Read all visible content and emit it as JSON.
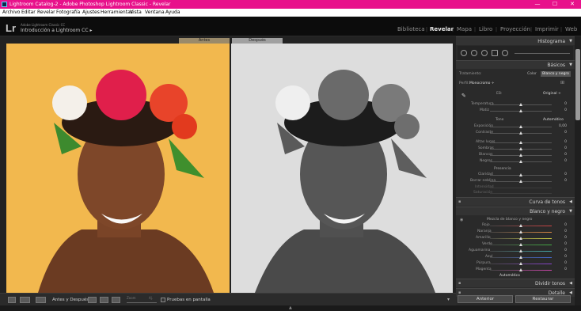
{
  "window": {
    "title": "Lightroom Catalog-2 - Adobe Photoshop Lightroom Classic - Revelar",
    "minimize": "—",
    "maximize": "☐",
    "close": "✕"
  },
  "menu": [
    "Archivo",
    "Editar",
    "Revelar",
    "Fotografía",
    "Ajustes",
    "Herramientas",
    "Vista",
    "Ventana",
    "Ayuda"
  ],
  "identity": {
    "logo": "Lr",
    "subtitle": "Adobe Lightroom Classic CC",
    "catalog": "Introducción a Lightroom CC ▸"
  },
  "modules": [
    "Biblioteca",
    "Revelar",
    "Mapa",
    "Libro",
    "Proyección",
    "Imprimir",
    "Web"
  ],
  "active_module": "Revelar",
  "view_labels": {
    "before": "Antes",
    "after": "Después"
  },
  "toolbar": {
    "mode_label": "Antes y Después:",
    "zoom_label": "Zoom",
    "fit_label": "Aj.",
    "proofing_label": "Pruebas en pantalla"
  },
  "panels": {
    "histogram": "Histograma",
    "basic": "Básicos",
    "tone_curve": "Curva de tonos",
    "bw": "Blanco y negro",
    "split_toning": "Dividir tonos",
    "detail": "Detalle"
  },
  "basic": {
    "treatment_label": "Tratamiento:",
    "color": "Color",
    "bw": "Blanco y negro",
    "profile_label": "Perfil:",
    "profile_value": "Monocromo ÷",
    "wb_label": "EB:",
    "wb_value": "Original ÷",
    "temperature": "Temperatura",
    "tint": "Matiz",
    "tone_label": "Tono",
    "auto": "Automático",
    "exposure": "Exposición",
    "exposure_value": "0,00",
    "contrast": "Contraste",
    "highlights": "Altas luces",
    "shadows": "Sombras",
    "whites": "Blancos",
    "blacks": "Negros",
    "presence_label": "Presencia",
    "clarity": "Claridad",
    "dehaze": "Borrar neblina",
    "vibrance": "Intensidad",
    "saturation": "Saturación",
    "zero": "0"
  },
  "bw_mix": {
    "title": "Mezcla de blanco y negro",
    "rows": [
      "Rojo",
      "Naranja",
      "Amarillo",
      "Verde",
      "Aguamarina",
      "Azul",
      "Púrpura",
      "Magenta"
    ],
    "zero": "0",
    "auto": "Automático"
  },
  "bottom_buttons": {
    "previous": "Anterior",
    "reset": "Restaurar"
  },
  "colors": {
    "title_bar": "#e8118b",
    "before_bg": "#f3b94f",
    "after_bg": "#dedede"
  }
}
